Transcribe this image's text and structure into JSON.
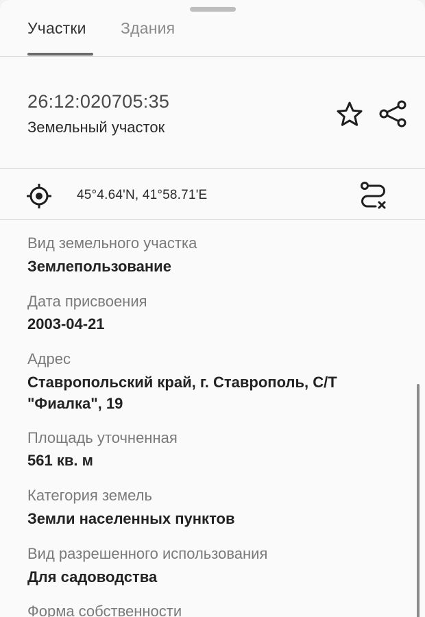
{
  "tabs": [
    {
      "label": "Участки",
      "active": true
    },
    {
      "label": "Здания",
      "active": false
    }
  ],
  "header": {
    "cadastral_number": "26:12:020705:35",
    "object_type": "Земельный участок"
  },
  "location": {
    "coordinates": "45°4.64'N, 41°58.71'E"
  },
  "fields": [
    {
      "label": "Вид земельного участка",
      "value": "Землепользование"
    },
    {
      "label": "Дата присвоения",
      "value": "2003-04-21"
    },
    {
      "label": "Адрес",
      "value": "Ставропольский край, г. Ставрополь, С/Т \"Фиалка\", 19"
    },
    {
      "label": "Площадь уточненная",
      "value": "561 кв. м"
    },
    {
      "label": "Категория земель",
      "value": "Земли населенных пунктов"
    },
    {
      "label": "Вид разрешенного использования",
      "value": "Для садоводства"
    },
    {
      "label": "Форма собственности",
      "value": ""
    }
  ],
  "icons": {
    "favorite": "star-icon",
    "share": "share-icon",
    "locate": "crosshair-icon",
    "route": "route-icon"
  },
  "colors": {
    "background": "#fafafa",
    "divider": "#d8d8d8",
    "label": "#7a7a7a",
    "value": "#222222",
    "tab_inactive": "#8a8a8a"
  }
}
